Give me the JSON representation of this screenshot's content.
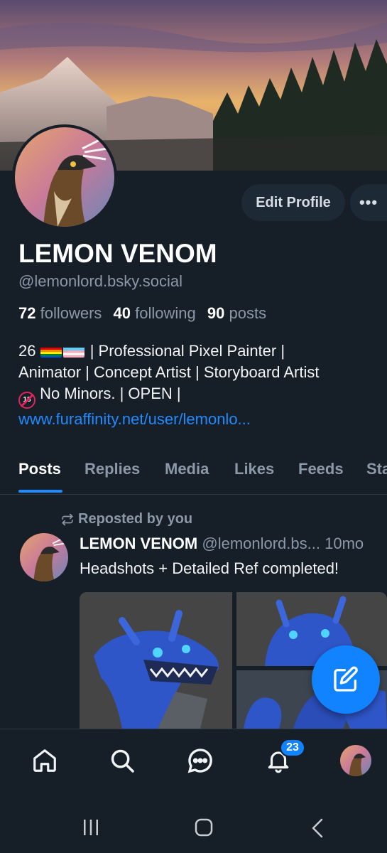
{
  "profile": {
    "display_name": "LEMON VENOM",
    "handle": "@lemonlord.bsky.social",
    "followers_count": "72",
    "followers_label": "followers",
    "following_count": "40",
    "following_label": "following",
    "posts_count": "90",
    "posts_label": "posts",
    "edit_label": "Edit Profile",
    "more_label": "•••",
    "bio_line1_prefix": "26",
    "bio_line1_rest": " | Professional Pixel Painter |",
    "bio_line2": "Animator | Concept Artist | Storyboard Artist",
    "bio_line3_badge": "18",
    "bio_line3": " No Minors. | OPEN |",
    "bio_link": "www.furaffinity.net/user/lemonlo..."
  },
  "tabs": [
    {
      "label": "Posts",
      "active": true
    },
    {
      "label": "Replies"
    },
    {
      "label": "Media"
    },
    {
      "label": "Likes"
    },
    {
      "label": "Feeds"
    },
    {
      "label": "Sta"
    }
  ],
  "post": {
    "repost_label": "Reposted by you",
    "author_name": "LEMON VENOM",
    "author_meta": "@lemonlord.bs... 10mo",
    "text": "Headshots + Detailed Ref completed!"
  },
  "nav": {
    "notifications_badge": "23",
    "icons": [
      "home-icon",
      "search-icon",
      "chat-icon",
      "bell-icon",
      "avatar"
    ]
  },
  "colors": {
    "background": "#161e27",
    "accent": "#208bfe",
    "muted": "#8b98a8"
  }
}
